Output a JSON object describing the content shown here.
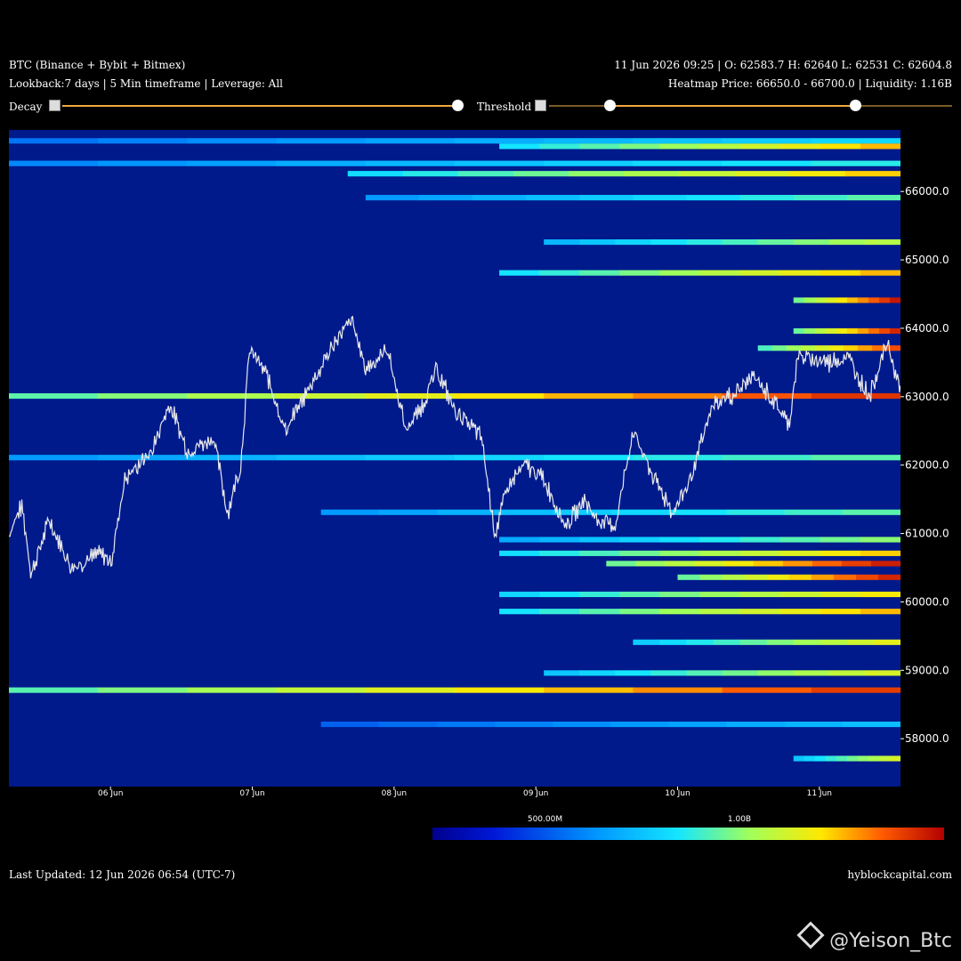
{
  "header": {
    "title": "BTC (Binance + Bybit + Bitmex)",
    "subtitle": "Lookback:7 days | 5 Min timeframe | Leverage: All",
    "ohlc": "11 Jun 2026 09:25 | O: 62583.7 H: 62640 L: 62531 C: 62604.8",
    "heatmap_info": "Heatmap Price: 66650.0 - 66700.0 | Liquidity: 1.16B"
  },
  "controls": {
    "decay_label": "Decay",
    "decay_value": 1.0,
    "threshold_label": "Threshold",
    "threshold_low": 0.15,
    "threshold_high": 0.76,
    "slider_color": "#f0a640"
  },
  "chart_data": {
    "type": "heatmap",
    "y_axis": {
      "range": [
        57300,
        66900
      ],
      "ticks": [
        66000.0,
        65000.0,
        64000.0,
        63000.0,
        62000.0,
        61000.0,
        60000.0,
        59000.0,
        58000.0
      ]
    },
    "x_axis": {
      "ticks": [
        "06 Jun",
        "07 Jun",
        "08 Jun",
        "09 Jun",
        "10 Jun",
        "11 Jun"
      ]
    },
    "price_series": {
      "color": "#e8e8e8",
      "anchors": [
        [
          0,
          61000
        ],
        [
          0.015,
          61400
        ],
        [
          0.025,
          60400
        ],
        [
          0.045,
          61200
        ],
        [
          0.07,
          60500
        ],
        [
          0.1,
          60700
        ],
        [
          0.115,
          60600
        ],
        [
          0.13,
          61800
        ],
        [
          0.16,
          62200
        ],
        [
          0.18,
          62900
        ],
        [
          0.2,
          62200
        ],
        [
          0.23,
          62400
        ],
        [
          0.245,
          61300
        ],
        [
          0.26,
          62000
        ],
        [
          0.27,
          63700
        ],
        [
          0.29,
          63300
        ],
        [
          0.31,
          62500
        ],
        [
          0.34,
          63200
        ],
        [
          0.37,
          63900
        ],
        [
          0.385,
          64100
        ],
        [
          0.4,
          63400
        ],
        [
          0.425,
          63700
        ],
        [
          0.445,
          62500
        ],
        [
          0.465,
          62900
        ],
        [
          0.48,
          63400
        ],
        [
          0.5,
          62800
        ],
        [
          0.53,
          62400
        ],
        [
          0.545,
          61000
        ],
        [
          0.56,
          61700
        ],
        [
          0.58,
          62000
        ],
        [
          0.6,
          61800
        ],
        [
          0.625,
          61100
        ],
        [
          0.645,
          61500
        ],
        [
          0.66,
          61200
        ],
        [
          0.68,
          61100
        ],
        [
          0.7,
          62500
        ],
        [
          0.72,
          61900
        ],
        [
          0.745,
          61300
        ],
        [
          0.765,
          61800
        ],
        [
          0.79,
          62900
        ],
        [
          0.81,
          63000
        ],
        [
          0.835,
          63300
        ],
        [
          0.86,
          62900
        ],
        [
          0.875,
          62600
        ],
        [
          0.885,
          63600
        ],
        [
          0.92,
          63500
        ],
        [
          0.94,
          63600
        ],
        [
          0.965,
          63000
        ],
        [
          0.985,
          63800
        ],
        [
          1.0,
          63100
        ]
      ]
    },
    "liquidity_bands": [
      {
        "price": 66730,
        "start": 0.0,
        "intensity": 0.45
      },
      {
        "price": 66650,
        "start": 0.55,
        "intensity": 0.8
      },
      {
        "price": 66400,
        "start": 0.0,
        "intensity": 0.5
      },
      {
        "price": 66250,
        "start": 0.38,
        "intensity": 0.78
      },
      {
        "price": 65900,
        "start": 0.4,
        "intensity": 0.55
      },
      {
        "price": 65250,
        "start": 0.6,
        "intensity": 0.65
      },
      {
        "price": 64800,
        "start": 0.55,
        "intensity": 0.8
      },
      {
        "price": 64400,
        "start": 0.88,
        "intensity": 0.97
      },
      {
        "price": 63950,
        "start": 0.88,
        "intensity": 0.95
      },
      {
        "price": 63700,
        "start": 0.84,
        "intensity": 0.9
      },
      {
        "price": 63000,
        "start": 0.0,
        "intensity": 0.93
      },
      {
        "price": 62100,
        "start": 0.0,
        "intensity": 0.55
      },
      {
        "price": 61300,
        "start": 0.35,
        "intensity": 0.55
      },
      {
        "price": 60900,
        "start": 0.55,
        "intensity": 0.6
      },
      {
        "price": 60700,
        "start": 0.55,
        "intensity": 0.78
      },
      {
        "price": 60550,
        "start": 0.67,
        "intensity": 0.96
      },
      {
        "price": 60350,
        "start": 0.75,
        "intensity": 0.95
      },
      {
        "price": 60100,
        "start": 0.55,
        "intensity": 0.75
      },
      {
        "price": 59850,
        "start": 0.55,
        "intensity": 0.8
      },
      {
        "price": 59400,
        "start": 0.7,
        "intensity": 0.72
      },
      {
        "price": 58950,
        "start": 0.6,
        "intensity": 0.7
      },
      {
        "price": 58700,
        "start": 0.0,
        "intensity": 0.92
      },
      {
        "price": 58200,
        "start": 0.35,
        "intensity": 0.4
      },
      {
        "price": 57700,
        "start": 0.88,
        "intensity": 0.7
      }
    ],
    "colorbar": {
      "labels": [
        "500.00M",
        "1.00B"
      ],
      "label_positions": [
        0.22,
        0.6
      ]
    }
  },
  "footer": {
    "last_updated": "Last Updated: 12 Jun 2026 06:54 (UTC-7)",
    "site": "hyblockcapital.com"
  },
  "watermark": {
    "text": "@Yeison_Btc",
    "icon": "binance-diamond-icon"
  }
}
